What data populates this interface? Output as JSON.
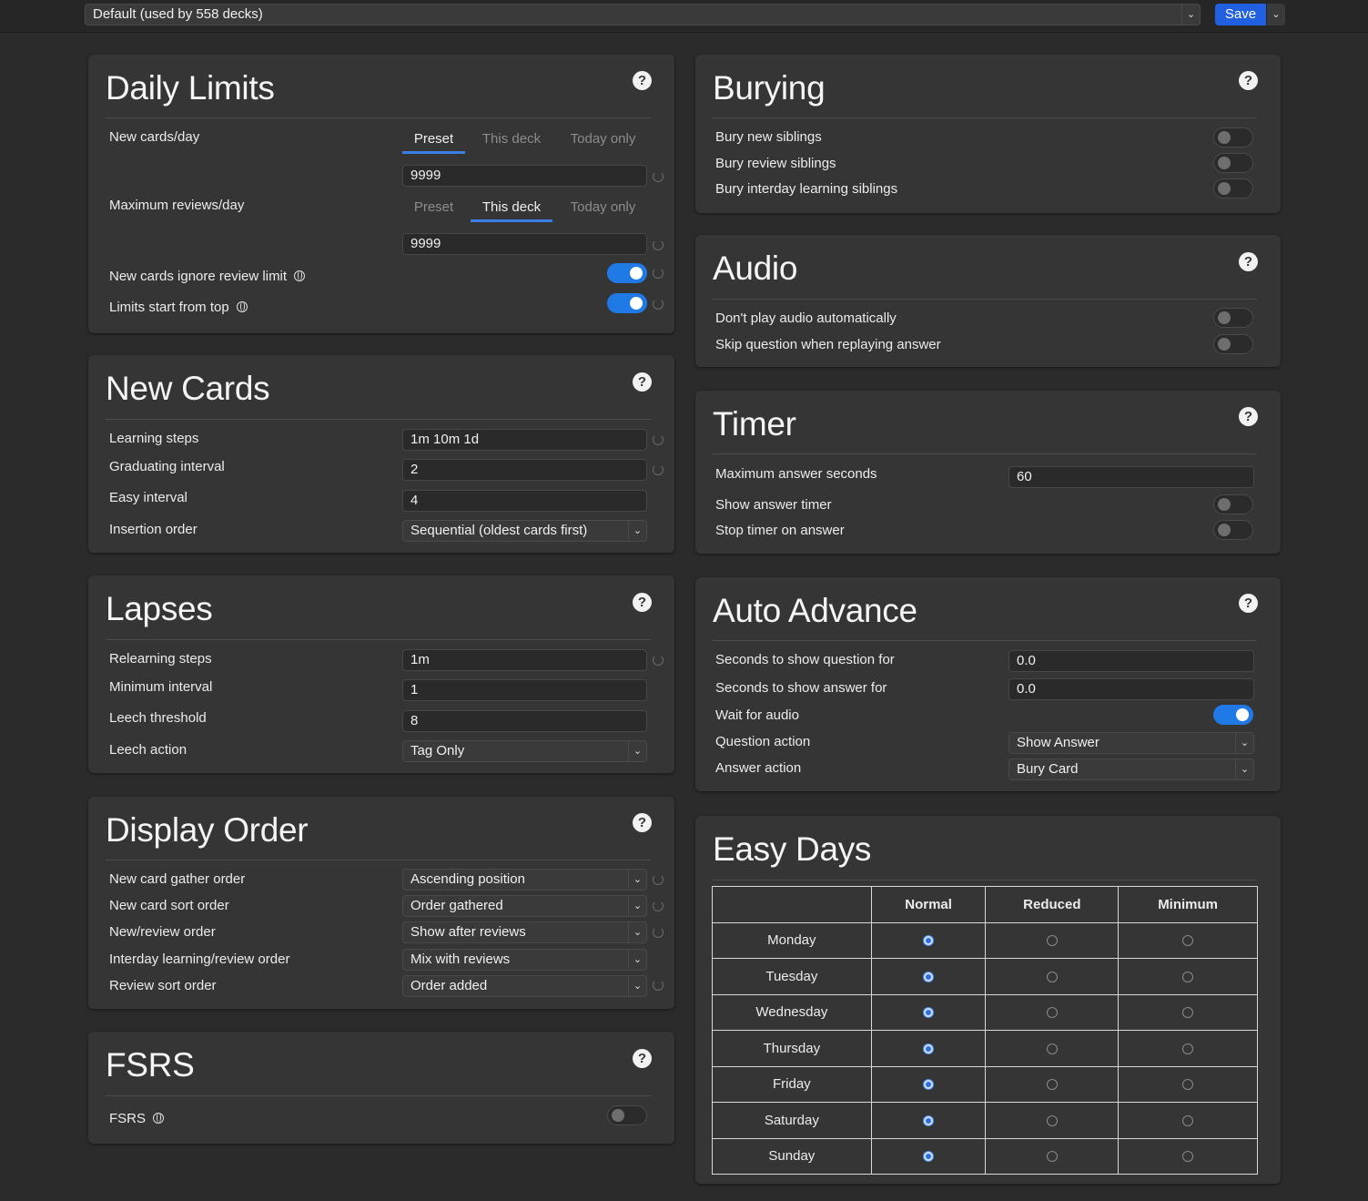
{
  "topbar": {
    "preset": "Default (used by 558 decks)",
    "save_label": "Save"
  },
  "daily_limits": {
    "title": "Daily Limits",
    "new_cards_label": "New cards/day",
    "new_tabs": [
      "Preset",
      "This deck",
      "Today only"
    ],
    "new_active_tab": "Preset",
    "new_value": "9999",
    "max_reviews_label": "Maximum reviews/day",
    "review_tabs": [
      "Preset",
      "This deck",
      "Today only"
    ],
    "review_active_tab": "This deck",
    "review_value": "9999",
    "ignore_review_limit_label": "New cards ignore review limit",
    "ignore_review_limit_on": true,
    "start_from_top_label": "Limits start from top",
    "start_from_top_on": true
  },
  "new_cards": {
    "title": "New Cards",
    "learning_steps_label": "Learning steps",
    "learning_steps_value": "1m 10m 1d",
    "graduating_label": "Graduating interval",
    "graduating_value": "2",
    "easy_label": "Easy interval",
    "easy_value": "4",
    "insertion_label": "Insertion order",
    "insertion_value": "Sequential (oldest cards first)"
  },
  "lapses": {
    "title": "Lapses",
    "relearning_label": "Relearning steps",
    "relearning_value": "1m",
    "min_interval_label": "Minimum interval",
    "min_interval_value": "1",
    "leech_threshold_label": "Leech threshold",
    "leech_threshold_value": "8",
    "leech_action_label": "Leech action",
    "leech_action_value": "Tag Only"
  },
  "display_order": {
    "title": "Display Order",
    "gather_label": "New card gather order",
    "gather_value": "Ascending position",
    "sort_label": "New card sort order",
    "sort_value": "Order gathered",
    "new_review_label": "New/review order",
    "new_review_value": "Show after reviews",
    "interday_label": "Interday learning/review order",
    "interday_value": "Mix with reviews",
    "review_sort_label": "Review sort order",
    "review_sort_value": "Order added"
  },
  "fsrs": {
    "title": "FSRS",
    "label": "FSRS",
    "on": false
  },
  "burying": {
    "title": "Burying",
    "new_siblings_label": "Bury new siblings",
    "review_siblings_label": "Bury review siblings",
    "interday_siblings_label": "Bury interday learning siblings"
  },
  "audio": {
    "title": "Audio",
    "dont_play_label": "Don't play audio automatically",
    "skip_question_label": "Skip question when replaying answer"
  },
  "timer": {
    "title": "Timer",
    "max_seconds_label": "Maximum answer seconds",
    "max_seconds_value": "60",
    "show_timer_label": "Show answer timer",
    "stop_timer_label": "Stop timer on answer"
  },
  "auto_advance": {
    "title": "Auto Advance",
    "question_seconds_label": "Seconds to show question for",
    "question_seconds_value": "0.0",
    "answer_seconds_label": "Seconds to show answer for",
    "answer_seconds_value": "0.0",
    "wait_audio_label": "Wait for audio",
    "wait_audio_on": true,
    "question_action_label": "Question action",
    "question_action_value": "Show Answer",
    "answer_action_label": "Answer action",
    "answer_action_value": "Bury Card"
  },
  "easy_days": {
    "title": "Easy Days",
    "columns": [
      "Normal",
      "Reduced",
      "Minimum"
    ],
    "days": [
      "Monday",
      "Tuesday",
      "Wednesday",
      "Thursday",
      "Friday",
      "Saturday",
      "Sunday"
    ],
    "selected": [
      "Normal",
      "Normal",
      "Normal",
      "Normal",
      "Normal",
      "Normal",
      "Normal"
    ]
  },
  "icons": {
    "help": "help-circle-icon",
    "globe": "globe-icon",
    "revert": "revert-icon",
    "chevron": "chevron-down-icon"
  },
  "colors": {
    "accent": "#2160e0",
    "toggle_on": "#1f7ae6",
    "background": "#2b2b2b",
    "card": "#353535"
  }
}
